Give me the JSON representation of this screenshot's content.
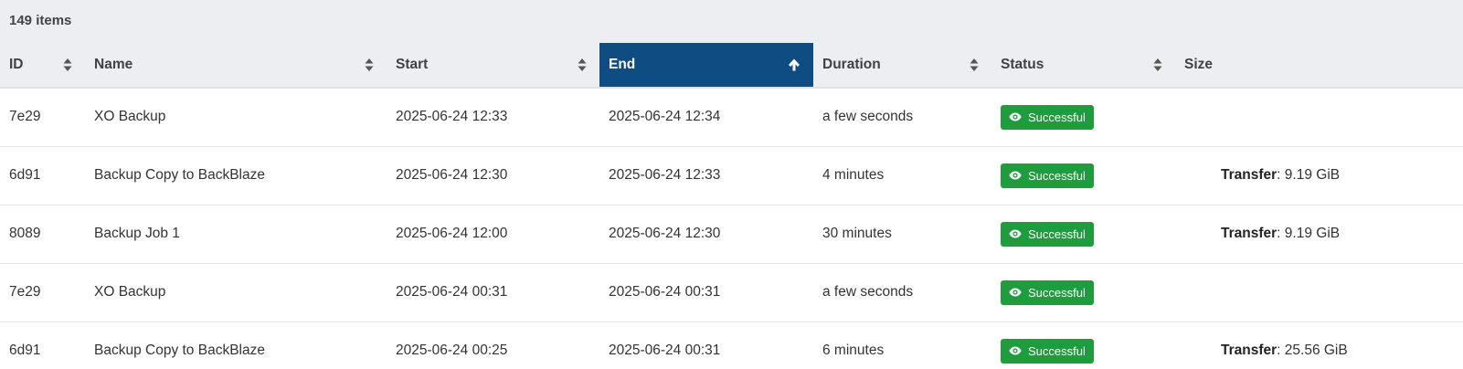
{
  "items_count": "149 items",
  "columns": [
    {
      "label": "ID",
      "sortable": true,
      "active": false
    },
    {
      "label": "Name",
      "sortable": true,
      "active": false
    },
    {
      "label": "Start",
      "sortable": true,
      "active": false
    },
    {
      "label": "End",
      "sortable": true,
      "active": true,
      "direction": "ascending",
      "icon": "arrow-up-icon"
    },
    {
      "label": "Duration",
      "sortable": true,
      "active": false
    },
    {
      "label": "Status",
      "sortable": true,
      "active": false
    },
    {
      "label": "Size",
      "sortable": false,
      "active": false
    }
  ],
  "sort_icon": "sort-icon",
  "status_icon": "eye-icon",
  "colors": {
    "header_bg": "#eceef1",
    "active_header_bg": "#0f4c81",
    "success_badge": "#1e9c3e"
  },
  "rows": [
    {
      "id": "7e29",
      "name": "XO Backup",
      "start": "2025-06-24 12:33",
      "end": "2025-06-24 12:34",
      "duration": "a few seconds",
      "status": "Successful",
      "size_label": "",
      "size_value": ""
    },
    {
      "id": "6d91",
      "name": "Backup Copy to BackBlaze",
      "start": "2025-06-24 12:30",
      "end": "2025-06-24 12:33",
      "duration": "4 minutes",
      "status": "Successful",
      "size_label": "Transfer",
      "size_value": ": 9.19 GiB"
    },
    {
      "id": "8089",
      "name": "Backup Job 1",
      "start": "2025-06-24 12:00",
      "end": "2025-06-24 12:30",
      "duration": "30 minutes",
      "status": "Successful",
      "size_label": "Transfer",
      "size_value": ": 9.19 GiB"
    },
    {
      "id": "7e29",
      "name": "XO Backup",
      "start": "2025-06-24 00:31",
      "end": "2025-06-24 00:31",
      "duration": "a few seconds",
      "status": "Successful",
      "size_label": "",
      "size_value": ""
    },
    {
      "id": "6d91",
      "name": "Backup Copy to BackBlaze",
      "start": "2025-06-24 00:25",
      "end": "2025-06-24 00:31",
      "duration": "6 minutes",
      "status": "Successful",
      "size_label": "Transfer",
      "size_value": ": 25.56 GiB"
    }
  ]
}
